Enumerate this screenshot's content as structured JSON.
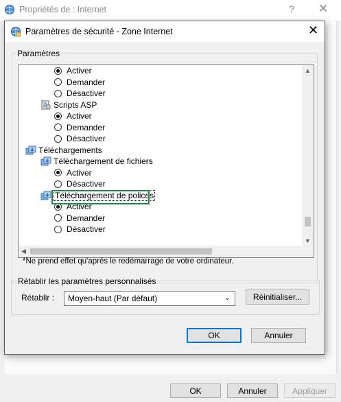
{
  "parent_window": {
    "title": "Propriétés de : Internet",
    "help_glyph": "?",
    "close_glyph": "✕",
    "buttons": {
      "ok": "OK",
      "cancel": "Annuler",
      "apply": "Appliquer"
    }
  },
  "dialog": {
    "title": "Paramètres de sécurité - Zone Internet",
    "close_glyph": "✕",
    "settings_group_label": "Paramètres",
    "tree": [
      {
        "kind": "radio",
        "label": "Activer",
        "checked": true
      },
      {
        "kind": "radio",
        "label": "Demander",
        "checked": false
      },
      {
        "kind": "radio",
        "label": "Désactiver",
        "checked": false
      },
      {
        "kind": "node",
        "label": "Scripts ASP",
        "icon": "script-icon"
      },
      {
        "kind": "radio",
        "label": "Activer",
        "checked": true
      },
      {
        "kind": "radio",
        "label": "Demander",
        "checked": false
      },
      {
        "kind": "radio",
        "label": "Désactiver",
        "checked": false
      },
      {
        "kind": "node",
        "label": "Téléchargements",
        "icon": "download-category-icon"
      },
      {
        "kind": "node",
        "label": "Téléchargement de fichiers",
        "icon": "download-setting-icon"
      },
      {
        "kind": "radio",
        "label": "Activer",
        "checked": true
      },
      {
        "kind": "radio",
        "label": "Désactiver",
        "checked": false
      },
      {
        "kind": "node",
        "label": "Téléchargement de polices",
        "icon": "download-setting-icon"
      },
      {
        "kind": "radio",
        "label": "Activer",
        "checked": true
      },
      {
        "kind": "radio",
        "label": "Demander",
        "checked": false
      },
      {
        "kind": "radio",
        "label": "Désactiver",
        "checked": false
      }
    ],
    "note": "*Ne prend effet qu'après le redémarrage de votre ordinateur.",
    "reset_group_label": "Rétablir les paramètres personnalisés",
    "reset_label": "Rétablir :",
    "reset_select_value": "Moyen-haut (Par défaut)",
    "reset_button": "Réinitialiser...",
    "ok_button": "OK",
    "cancel_button": "Annuler"
  },
  "colors": {
    "highlight_box": "#1e8a46",
    "default_button_border": "#0078d7"
  }
}
